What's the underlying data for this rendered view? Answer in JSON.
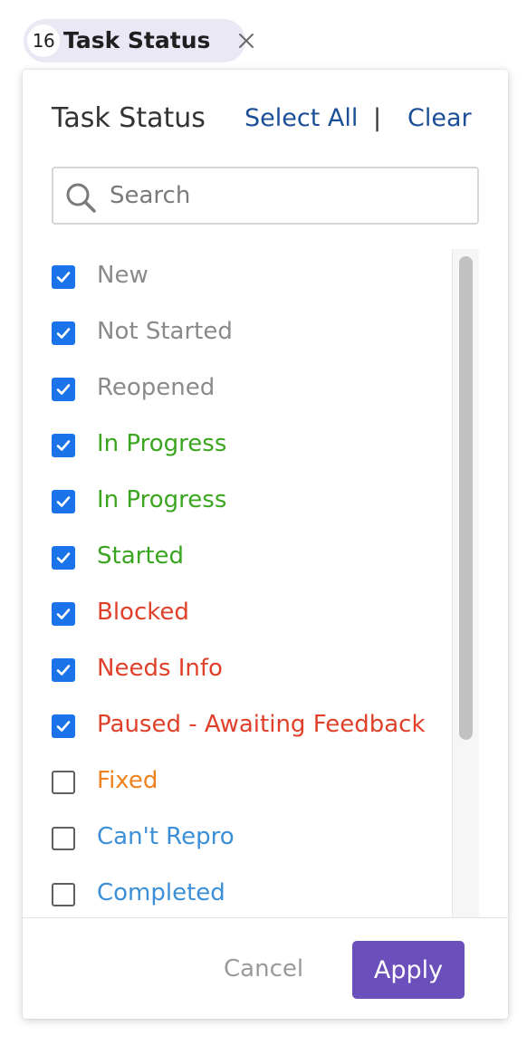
{
  "chip": {
    "count": "16",
    "label": "Task Status",
    "close_icon": "close-icon"
  },
  "panel": {
    "title": "Task Status",
    "select_all": "Select All",
    "separator": "|",
    "clear": "Clear"
  },
  "search": {
    "placeholder": "Search",
    "value": "",
    "icon": "search-icon"
  },
  "options": [
    {
      "label": "New",
      "checked": true,
      "color": "#8a8a8a"
    },
    {
      "label": "Not Started",
      "checked": true,
      "color": "#8a8a8a"
    },
    {
      "label": "Reopened",
      "checked": true,
      "color": "#8a8a8a"
    },
    {
      "label": "In Progress",
      "checked": true,
      "color": "#3aa61f"
    },
    {
      "label": "In Progress",
      "checked": true,
      "color": "#3aa61f"
    },
    {
      "label": "Started",
      "checked": true,
      "color": "#3aa61f"
    },
    {
      "label": "Blocked",
      "checked": true,
      "color": "#e0402a"
    },
    {
      "label": "Needs Info",
      "checked": true,
      "color": "#e0402a"
    },
    {
      "label": "Paused - Awaiting Feedback",
      "checked": true,
      "color": "#e0402a"
    },
    {
      "label": "Fixed",
      "checked": false,
      "color": "#f0821e"
    },
    {
      "label": "Can't Repro",
      "checked": false,
      "color": "#3c8fd6"
    },
    {
      "label": "Completed",
      "checked": false,
      "color": "#3c8fd6"
    }
  ],
  "footer": {
    "cancel_label": "Cancel",
    "apply_label": "Apply"
  },
  "colors": {
    "checkbox_checked": "#1a73e8",
    "apply_button": "#6b4fbb",
    "link": "#1a4e96",
    "chip_background": "#ebe8f6"
  }
}
